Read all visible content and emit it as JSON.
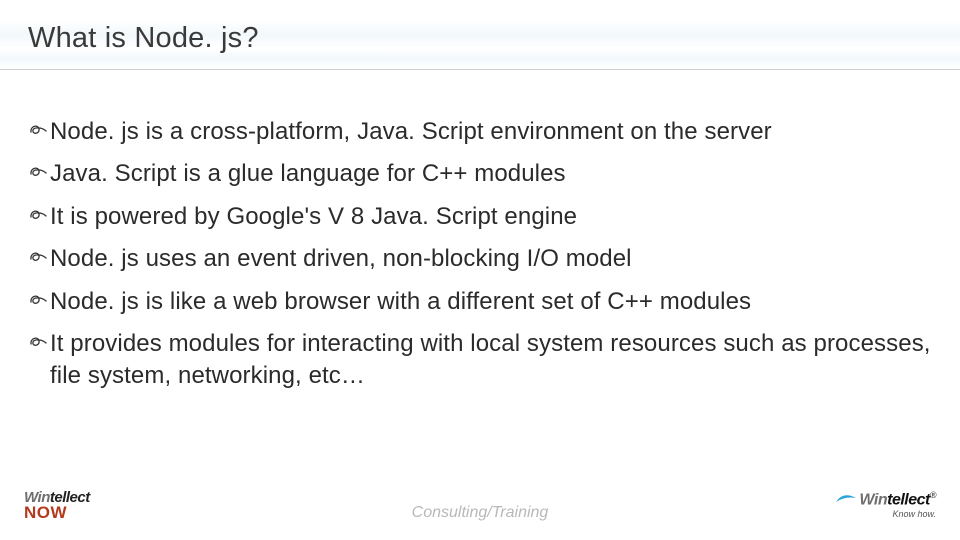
{
  "slide": {
    "title": "What is Node. js?",
    "bullets": [
      "Node. js is a cross-platform, Java. Script environment on the server",
      "Java. Script is a glue language for C++ modules",
      "It is powered by Google's V 8 Java. Script engine",
      "Node. js uses an event driven, non-blocking I/O model",
      "Node. js is like a web browser with a different set of C++ modules",
      "It provides modules for interacting with local system resources such as processes, file system, networking, etc…"
    ]
  },
  "footer": {
    "left_logo_top_part1": "Win",
    "left_logo_top_part2": "tellect",
    "left_logo_bottom": "NOW",
    "center_text": "Consulting/Training",
    "right_logo_part1": "Win",
    "right_logo_part2": "tellect",
    "right_logo_reg": "®",
    "right_logo_tag": "Know how."
  }
}
